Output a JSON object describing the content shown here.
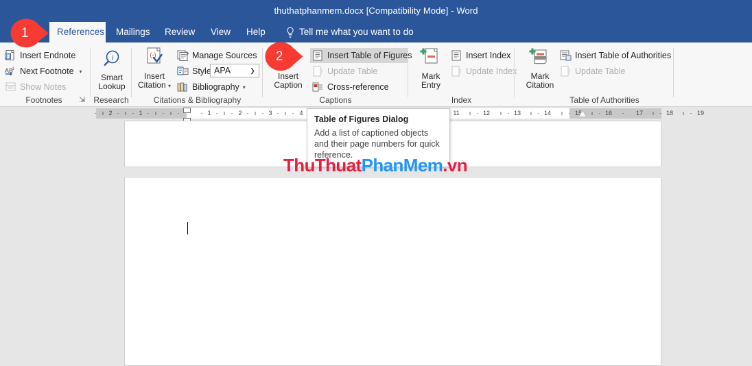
{
  "window": {
    "title": "thuthatphanmem.docx [Compatibility Mode]  -  Word",
    "accent_color": "#2b579a"
  },
  "tabs": [
    {
      "label": "References",
      "active": true
    },
    {
      "label": "Mailings",
      "active": false
    },
    {
      "label": "Review",
      "active": false
    },
    {
      "label": "View",
      "active": false
    },
    {
      "label": "Help",
      "active": false
    }
  ],
  "tell_me": {
    "label": "Tell me what you want to do",
    "icon": "lightbulb-icon"
  },
  "ribbon": {
    "groups": [
      {
        "name": "footnotes",
        "label": "Footnotes",
        "has_dialog_launcher": true,
        "commands": [
          {
            "label": "Insert Endnote",
            "icon": "insert-endnote-icon",
            "disabled": false
          },
          {
            "label": "Next Footnote",
            "icon": "next-footnote-icon",
            "disabled": false,
            "dropdown": true
          },
          {
            "label": "Show Notes",
            "icon": "show-notes-icon",
            "disabled": true
          }
        ]
      },
      {
        "name": "research",
        "label": "Research",
        "big_commands": [
          {
            "line1": "Smart",
            "line2": "Lookup",
            "icon": "smart-lookup-icon"
          }
        ]
      },
      {
        "name": "citations-bibliography",
        "label": "Citations & Bibliography",
        "big_commands": [
          {
            "line1": "Insert",
            "line2": "Citation",
            "icon": "insert-citation-icon",
            "dropdown": true
          }
        ],
        "commands": [
          {
            "label": "Manage Sources",
            "icon": "manage-sources-icon",
            "disabled": false
          },
          {
            "label": "Style:",
            "icon": "style-icon",
            "disabled": false
          },
          {
            "label": "Bibliography",
            "icon": "bibliography-icon",
            "disabled": false,
            "dropdown": true
          }
        ],
        "style_combo": {
          "value": "APA"
        }
      },
      {
        "name": "captions",
        "label": "Captions",
        "big_commands": [
          {
            "line1": "Insert",
            "line2": "Caption",
            "icon": "insert-caption-icon"
          }
        ],
        "commands": [
          {
            "label": "Insert Table of Figures",
            "icon": "insert-table-of-figures-icon",
            "disabled": false,
            "highlighted": true
          },
          {
            "label": "Update Table",
            "icon": "update-table-icon",
            "disabled": true
          },
          {
            "label": "Cross-reference",
            "icon": "cross-reference-icon",
            "disabled": false
          }
        ]
      },
      {
        "name": "index",
        "label": "Index",
        "big_commands": [
          {
            "line1": "Mark",
            "line2": "Entry",
            "icon": "mark-entry-icon"
          }
        ],
        "commands": [
          {
            "label": "Insert Index",
            "icon": "insert-index-icon",
            "disabled": false
          },
          {
            "label": "Update Index",
            "icon": "update-index-icon",
            "disabled": true
          }
        ]
      },
      {
        "name": "table-of-authorities",
        "label": "Table of Authorities",
        "big_commands": [
          {
            "line1": "Mark",
            "line2": "Citation",
            "icon": "mark-citation-icon"
          }
        ],
        "commands": [
          {
            "label": "Insert Table of Authorities",
            "icon": "insert-table-of-authorities-icon",
            "disabled": false
          },
          {
            "label": "Update Table",
            "icon": "update-table-2-icon",
            "disabled": true
          }
        ]
      }
    ]
  },
  "tooltip": {
    "title": "Table of Figures Dialog",
    "body": "Add a list of captioned objects and their page numbers for quick reference."
  },
  "ruler": {
    "left_ticks": [
      "2",
      "1",
      "1",
      "2",
      "3",
      "4"
    ],
    "right_ticks": [
      "11",
      "12",
      "13",
      "14",
      "15",
      "16",
      "17",
      "18",
      "19"
    ]
  },
  "callouts": [
    {
      "number": "1",
      "color": "#f73b33"
    },
    {
      "number": "2",
      "color": "#f73b33"
    }
  ],
  "watermark": {
    "part1": "ThuThuat",
    "part2": "PhanMem",
    "part3": ".vn",
    "color1": "#ec1c3f",
    "color2": "#2196f3"
  }
}
